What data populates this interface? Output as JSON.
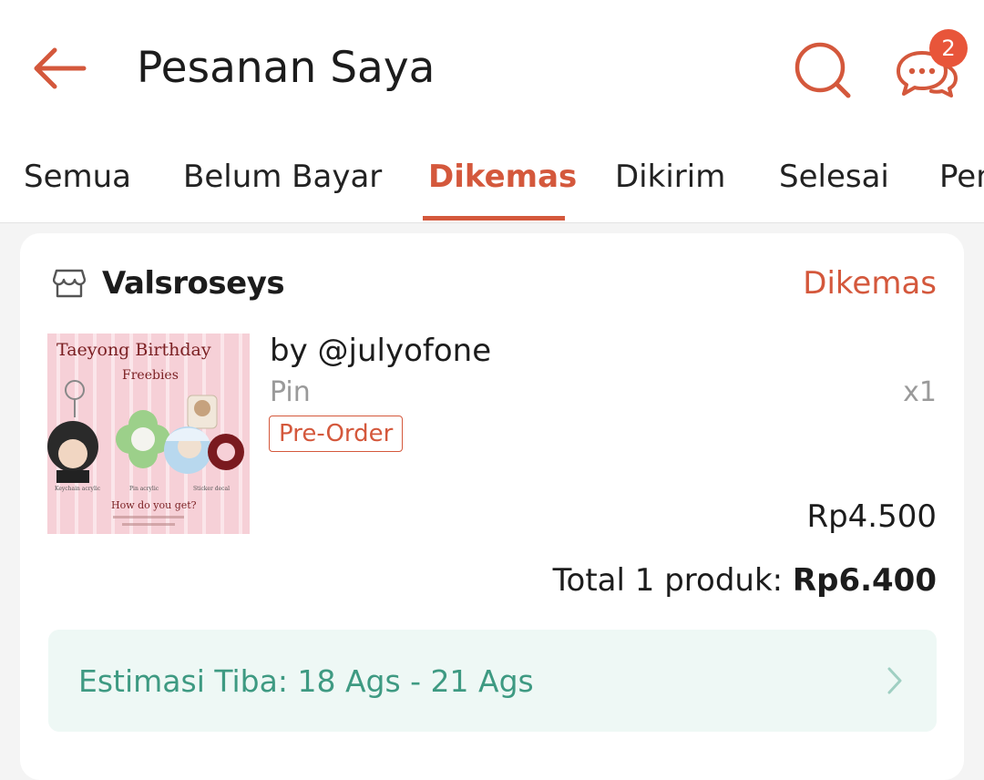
{
  "header": {
    "title": "Pesanan Saya",
    "chat_badge_count": "2",
    "icons": {
      "back": "arrow-left-icon",
      "search": "search-icon",
      "chat": "chat-icon"
    }
  },
  "tabs": [
    {
      "label": "Semua"
    },
    {
      "label": "Belum Bayar"
    },
    {
      "label": "Dikemas",
      "active": true
    },
    {
      "label": "Dikirim"
    },
    {
      "label": "Selesai"
    },
    {
      "label": "Pen"
    }
  ],
  "order": {
    "shop_name": "Valsroseys",
    "status": "Dikemas",
    "product": {
      "name": "by @julyofone",
      "variant": "Pin",
      "quantity": "x1",
      "tag": "Pre-Order",
      "price": "Rp4.500",
      "thumbnail": {
        "title": "Taeyong Birthday",
        "subtitle": "Freebies",
        "labels": [
          "Keychain acrylic",
          "Pin acrylic",
          "Sticker decal"
        ],
        "footer": "How do you get?"
      }
    },
    "total_label": "Total 1 produk:",
    "total_value": "Rp6.400",
    "eta": "Estimasi Tiba: 18 Ags - 21 Ags"
  },
  "colors": {
    "accent": "#d4583c",
    "badge": "#e8553a",
    "eta_text": "#3e9a82",
    "eta_bg": "#eef8f5"
  }
}
